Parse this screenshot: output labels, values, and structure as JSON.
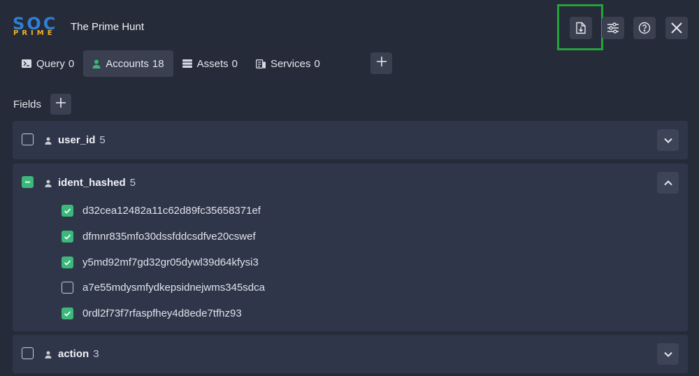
{
  "header": {
    "logo_top": "SOC",
    "logo_bottom": "PRIME",
    "title": "The Prime Hunt",
    "buttons": [
      {
        "name": "export",
        "icon": "file-download-icon"
      },
      {
        "name": "settings",
        "icon": "sliders-icon"
      },
      {
        "name": "help",
        "icon": "help-circle-icon"
      },
      {
        "name": "close",
        "icon": "close-icon"
      }
    ],
    "highlight_color": "#23a33a"
  },
  "tabs": [
    {
      "label": "Query",
      "count": "0",
      "icon": "terminal-icon",
      "active": false
    },
    {
      "label": "Accounts",
      "count": "18",
      "icon": "user-icon",
      "active": true
    },
    {
      "label": "Assets",
      "count": "0",
      "icon": "server-icon",
      "active": false
    },
    {
      "label": "Services",
      "count": "0",
      "icon": "services-icon",
      "active": false
    }
  ],
  "fields_label": "Fields",
  "fields": [
    {
      "name": "user_id",
      "count": "5",
      "state": "unchecked",
      "expanded": false
    },
    {
      "name": "ident_hashed",
      "count": "5",
      "state": "partial",
      "expanded": true,
      "values": [
        {
          "text": "d32cea12482a11c62d89fc35658371ef",
          "checked": true
        },
        {
          "text": "dfmnr835mfo30dssfddcsdfve20cswef",
          "checked": true
        },
        {
          "text": "y5md92mf7gd32gr05dywl39d64kfysi3",
          "checked": true
        },
        {
          "text": "a7e55mdysmfydkepsidnejwms345sdca",
          "checked": false
        },
        {
          "text": "0rdl2f73f7rfaspfhey4d8ede7tfhz93",
          "checked": true
        }
      ]
    },
    {
      "name": "action",
      "count": "3",
      "state": "unchecked",
      "expanded": false
    }
  ],
  "colors": {
    "background": "#262b39",
    "panel": "#30364a",
    "button": "#3a4050",
    "check_green": "#3bb87a"
  }
}
